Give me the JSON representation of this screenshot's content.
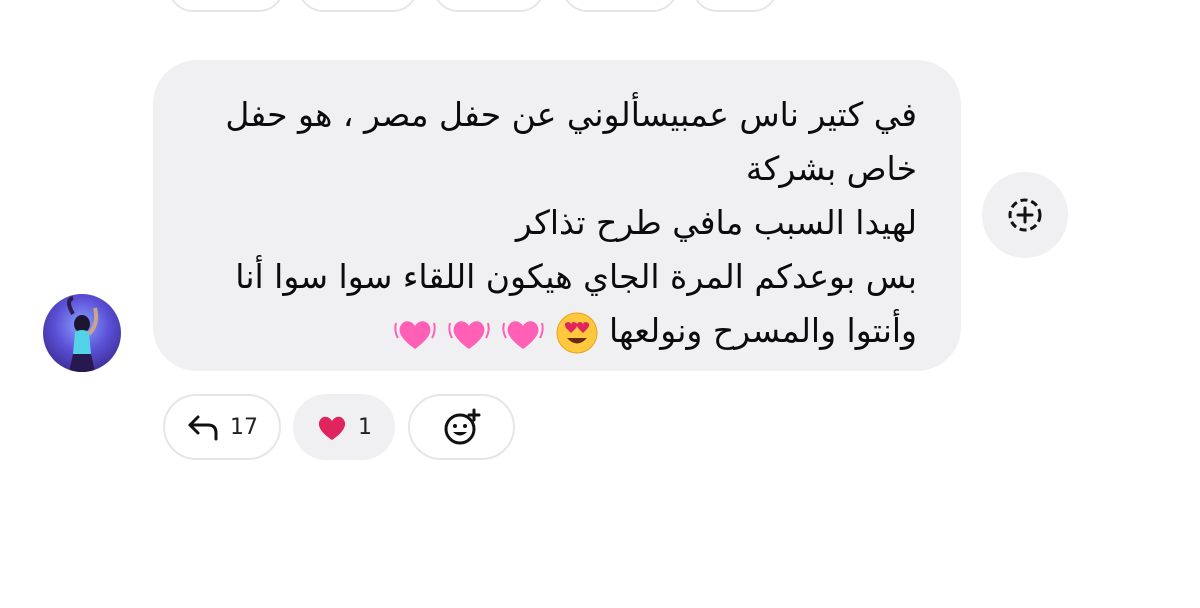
{
  "message": {
    "lines": [
      "في كتير ناس عمبيسألوني عن حفل مصر ، هو حفل",
      "خاص بشركة",
      "لهيدا السبب مافي طرح تذاكر",
      "بس بوعدكم المرة الجاي هيكون اللقاء سوا سوا أنا",
      "وأنتوا والمسرح ونولعها"
    ],
    "emojis": [
      "heart-eyes-emoji",
      "growing-heart-emoji",
      "growing-heart-emoji",
      "growing-heart-emoji"
    ]
  },
  "reactions": {
    "reply_count": "17",
    "heart_count": "1"
  },
  "colors": {
    "bubble_bg": "#f0f0f2",
    "heart_red": "#e0245e",
    "heart_pink": "#ff5fb5",
    "emoji_yellow": "#ffc83d"
  }
}
